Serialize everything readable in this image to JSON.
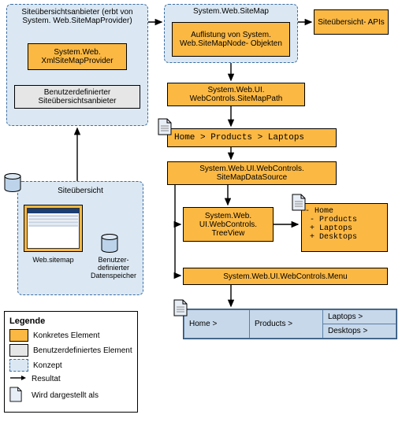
{
  "providers": {
    "title": "Siteübersichtsanbieter (erbt von System. Web.SiteMapProvider)",
    "xml": "System.Web. XmlSiteMapProvider",
    "custom": "Benutzerdefinierter Siteübersichtsanbieter"
  },
  "sitemap": {
    "title": "System.Web.SiteMap",
    "nodes": "Auflistung von System. Web.SiteMapNode- Objekten",
    "apis": "Siteübersicht- APIs"
  },
  "overview": {
    "title": "Siteübersicht",
    "file": "Web.sitemap",
    "store": "Benutzer- definierter Datenspeicher"
  },
  "path": {
    "ctrl": "System.Web.UI. WebControls.SiteMapPath",
    "breadcrumb": "Home > Products > Laptops"
  },
  "ds": "System.Web.UI.WebControls. SiteMapDataSource",
  "tree": {
    "ctrl": "System.Web. UI.WebControls. TreeView",
    "l1": "- Home",
    "l2": " - Products",
    "l3": " + Laptops",
    "l4": " + Desktops"
  },
  "menu": {
    "ctrl": "System.Web.UI.WebControls.Menu",
    "c1": "Home >",
    "c2": "Products >",
    "c3": "Laptops >",
    "c4": "Desktops >"
  },
  "legend": {
    "title": "Legende",
    "concrete": "Konkretes Element",
    "userdef": "Benutzerdefiniertes Element",
    "concept": "Konzept",
    "result": "Resultat",
    "rendered": "Wird dargestellt als"
  }
}
